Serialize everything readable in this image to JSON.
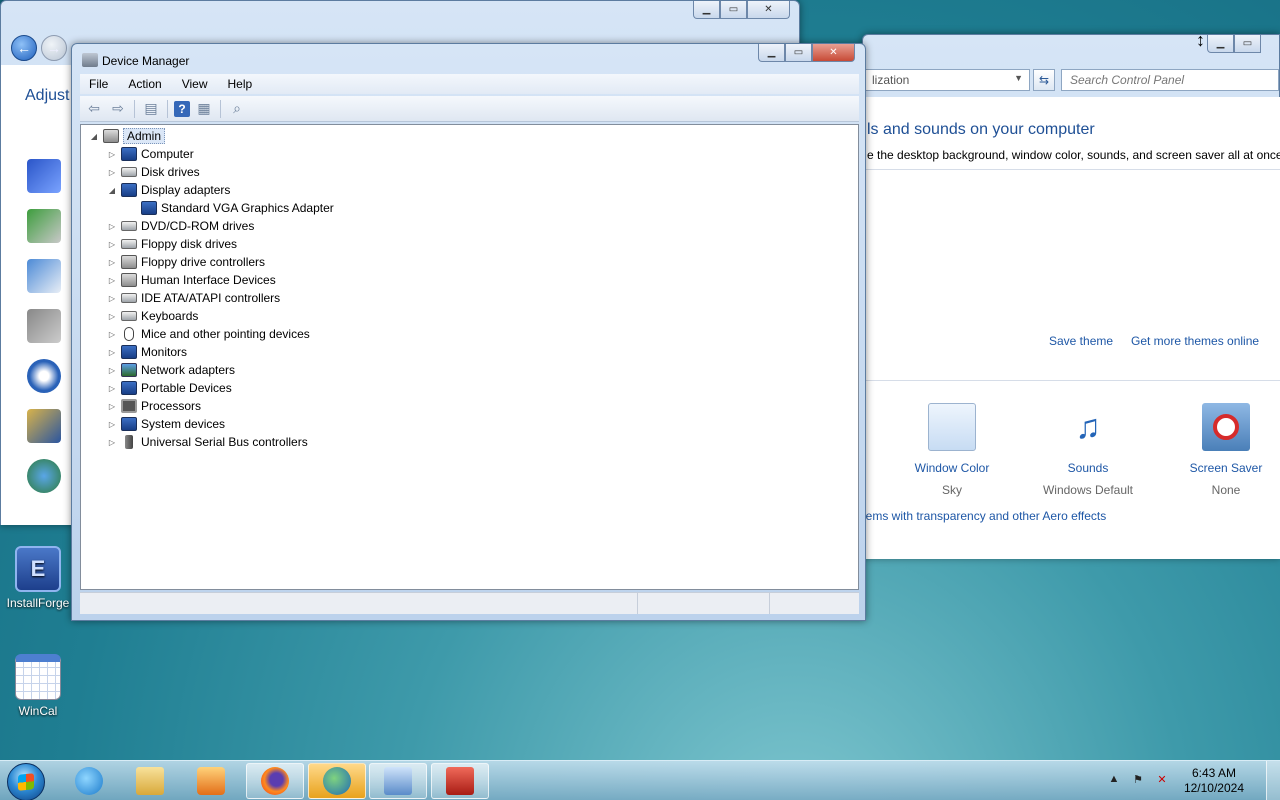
{
  "desktop": {
    "icons": [
      {
        "label": "InstallForge"
      },
      {
        "label": "WinCal"
      }
    ]
  },
  "back_window_left": {
    "adjust_text": "Adjust"
  },
  "back_window_right": {
    "address_text": "lization",
    "search_placeholder": "Search Control Panel",
    "heading": "ls and sounds on your computer",
    "subheading": "e the desktop background, window color, sounds, and screen saver all at once.",
    "save_theme": "Save theme",
    "get_more_themes": "Get more themes online",
    "items": [
      {
        "label": "Window Color",
        "value": "Sky",
        "icon": "window-color-icon"
      },
      {
        "label": "Sounds",
        "value": "Windows Default",
        "icon": "sounds-icon"
      },
      {
        "label": "Screen Saver",
        "value": "None",
        "icon": "screen-saver-icon"
      }
    ],
    "aero_link": "lems with transparency and other Aero effects"
  },
  "device_manager": {
    "title": "Device Manager",
    "menu": [
      "File",
      "Action",
      "View",
      "Help"
    ],
    "toolbar": [
      "back-icon",
      "forward-icon",
      "show-hide-tree-icon",
      "help-icon",
      "properties-icon",
      "scan-hardware-icon"
    ],
    "root": "Admin",
    "nodes": [
      {
        "label": "Computer",
        "expander": "▷",
        "icon": "computer-icon"
      },
      {
        "label": "Disk drives",
        "expander": "▷",
        "icon": "disk-drive-icon"
      },
      {
        "label": "Display adapters",
        "expander": "◢",
        "icon": "display-adapter-icon"
      },
      {
        "label": "Standard VGA Graphics Adapter",
        "expander": "",
        "icon": "display-adapter-icon",
        "child": true
      },
      {
        "label": "DVD/CD-ROM drives",
        "expander": "▷",
        "icon": "dvd-drive-icon"
      },
      {
        "label": "Floppy disk drives",
        "expander": "▷",
        "icon": "floppy-drive-icon"
      },
      {
        "label": "Floppy drive controllers",
        "expander": "▷",
        "icon": "floppy-controller-icon"
      },
      {
        "label": "Human Interface Devices",
        "expander": "▷",
        "icon": "hid-icon"
      },
      {
        "label": "IDE ATA/ATAPI controllers",
        "expander": "▷",
        "icon": "ide-controller-icon"
      },
      {
        "label": "Keyboards",
        "expander": "▷",
        "icon": "keyboard-icon"
      },
      {
        "label": "Mice and other pointing devices",
        "expander": "▷",
        "icon": "mouse-icon"
      },
      {
        "label": "Monitors",
        "expander": "▷",
        "icon": "monitor-icon"
      },
      {
        "label": "Network adapters",
        "expander": "▷",
        "icon": "network-adapter-icon"
      },
      {
        "label": "Portable Devices",
        "expander": "▷",
        "icon": "portable-device-icon"
      },
      {
        "label": "Processors",
        "expander": "▷",
        "icon": "processor-icon"
      },
      {
        "label": "System devices",
        "expander": "▷",
        "icon": "system-device-icon"
      },
      {
        "label": "Universal Serial Bus controllers",
        "expander": "▷",
        "icon": "usb-icon"
      }
    ]
  },
  "taskbar": {
    "apps": [
      "ie-icon",
      "explorer-icon",
      "media-player-icon",
      "firefox-icon",
      "install-manager-icon",
      "control-panel-icon",
      "toolbox-icon"
    ],
    "clock_time": "6:43 AM",
    "clock_date": "12/10/2024"
  },
  "colors": {
    "accent_link": "#1e57a6",
    "desktop_teal": "#1f7e92"
  }
}
